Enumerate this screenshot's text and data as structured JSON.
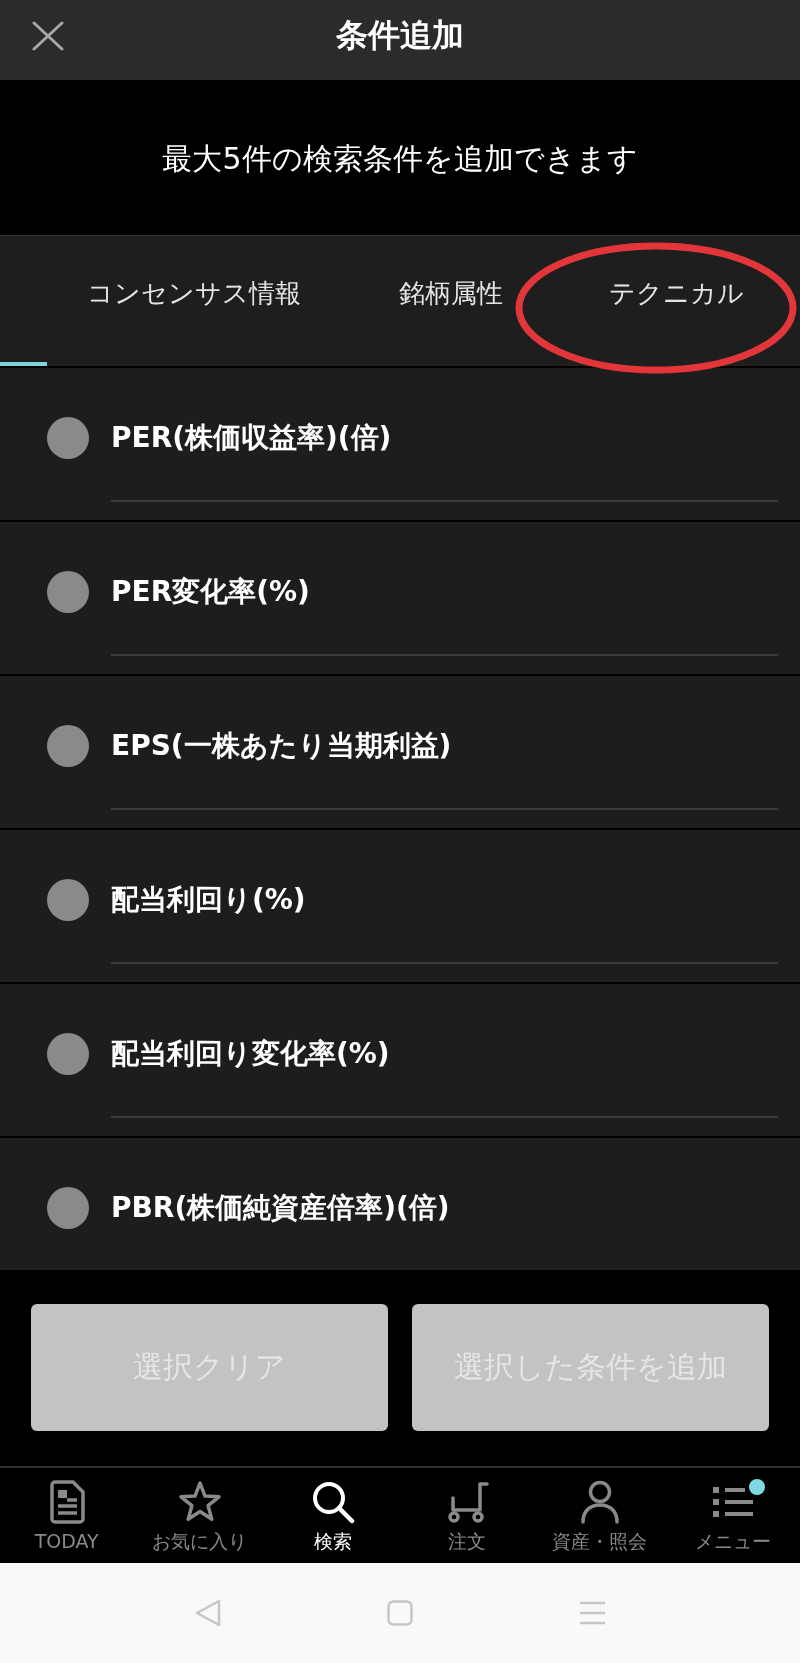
{
  "header": {
    "title": "条件追加"
  },
  "notice": "最大5件の検索条件を追加できます",
  "tabs": [
    {
      "label": "コンセンサス情報",
      "selected": false,
      "circled": false
    },
    {
      "label": "銘柄属性",
      "selected": false,
      "circled": false
    },
    {
      "label": "テクニカル",
      "selected": false,
      "circled": true
    }
  ],
  "conditions": [
    {
      "label": "PER(株価収益率)(倍)",
      "selected": false
    },
    {
      "label": "PER変化率(%)",
      "selected": false
    },
    {
      "label": "EPS(一株あたり当期利益)",
      "selected": false
    },
    {
      "label": "配当利回り(%)",
      "selected": false
    },
    {
      "label": "配当利回り変化率(%)",
      "selected": false
    },
    {
      "label": "PBR(株価純資産倍率)(倍)",
      "selected": false
    }
  ],
  "buttons": [
    {
      "label": "選択クリア",
      "disabled": true
    },
    {
      "label": "選択した条件を追加",
      "disabled": true
    }
  ],
  "bottom_nav": [
    {
      "kind": "today",
      "label": "TODAY",
      "selected": false,
      "badge": false
    },
    {
      "kind": "favorite",
      "label": "お気に入り",
      "selected": false,
      "badge": false
    },
    {
      "kind": "search",
      "label": "検索",
      "selected": true,
      "badge": false
    },
    {
      "kind": "order",
      "label": "注文",
      "selected": false,
      "badge": false
    },
    {
      "kind": "account",
      "label": "資産・照会",
      "selected": false,
      "badge": false
    },
    {
      "kind": "menu",
      "label": "メニュー",
      "selected": false,
      "badge": true
    }
  ]
}
